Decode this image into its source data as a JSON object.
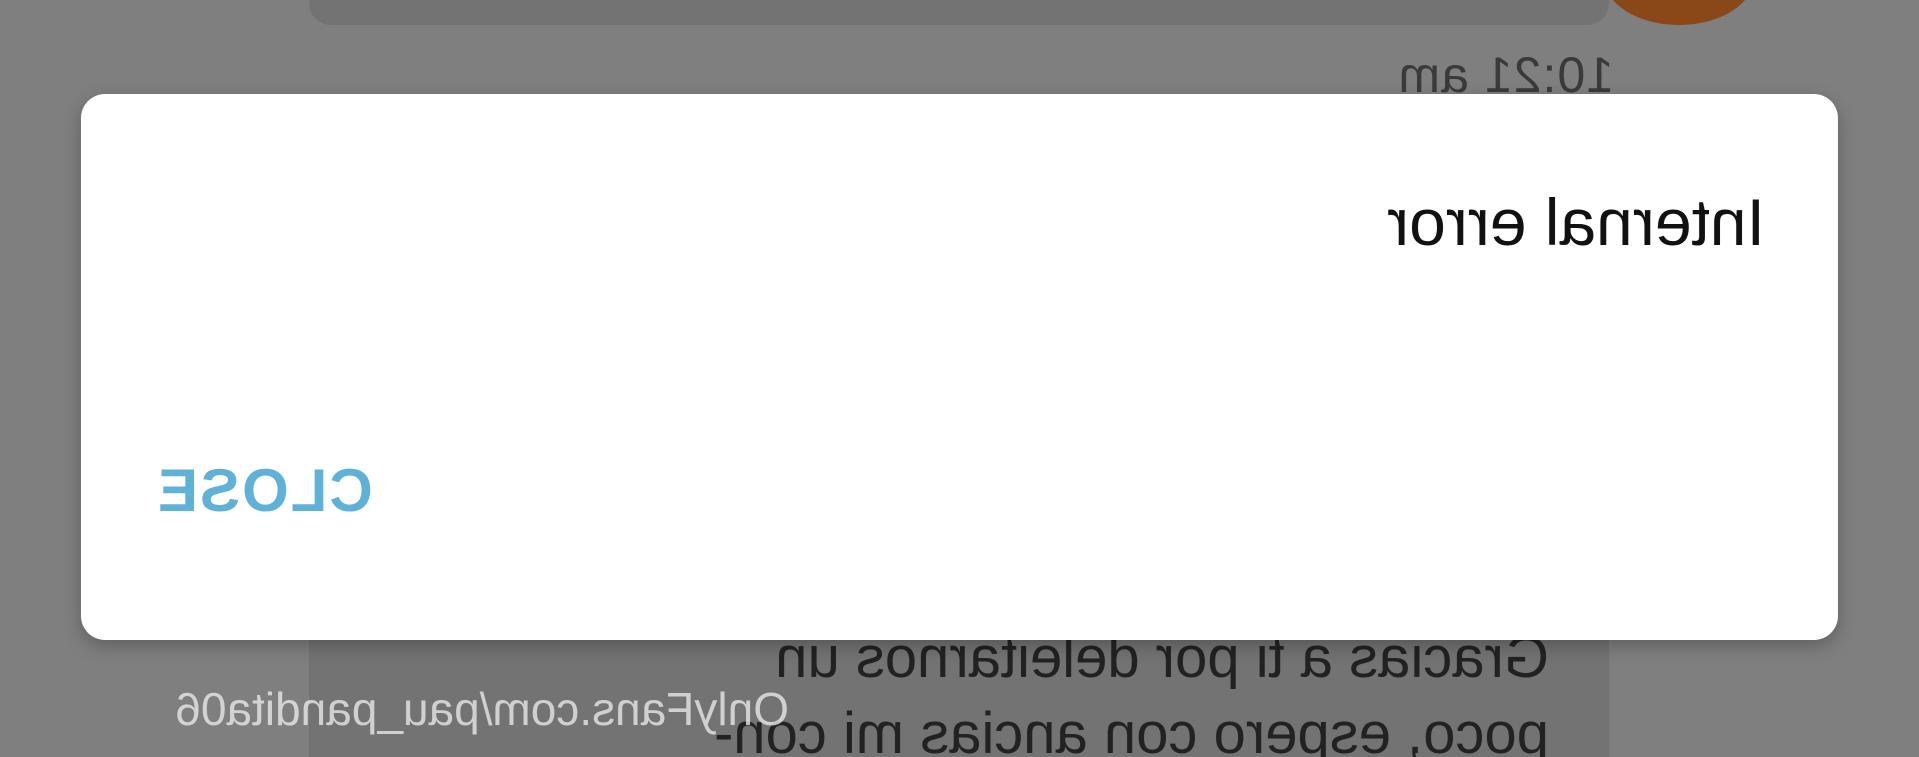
{
  "chat": {
    "timestamp": "10:21 am",
    "message_lines": "Gracias a ti por deleitarnos un\npoco, espero con ancias mi con-"
  },
  "watermark": "OnlyFans.com/pau_pandita06",
  "dialog": {
    "message": "Internal error",
    "close_label": "CLOSE"
  },
  "colors": {
    "overlay_bg": "#7f7f7f",
    "dialog_bg": "#ffffff",
    "accent": "#5fb1d8",
    "avatar": "#8a4718"
  },
  "view": {
    "mirrored_horizontally": true
  }
}
